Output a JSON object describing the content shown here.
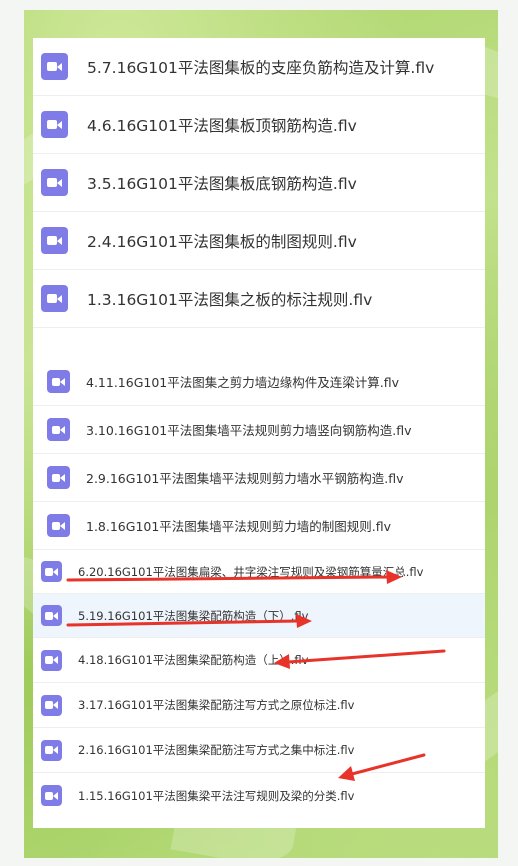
{
  "files": {
    "group_large": [
      {
        "name": "5.7.16G101平法图集板的支座负筋构造及计算.flv",
        "icon": "video-file-icon"
      },
      {
        "name": "4.6.16G101平法图集板顶钢筋构造.flv",
        "icon": "video-file-icon"
      },
      {
        "name": "3.5.16G101平法图集板底钢筋构造.flv",
        "icon": "video-file-icon"
      },
      {
        "name": "2.4.16G101平法图集板的制图规则.flv",
        "icon": "video-file-icon"
      },
      {
        "name": "1.3.16G101平法图集之板的标注规则.flv",
        "icon": "video-file-icon"
      }
    ],
    "group_medium": [
      {
        "name": "4.11.16G101平法图集之剪力墙边缘构件及连梁计算.flv",
        "icon": "video-file-icon"
      },
      {
        "name": "3.10.16G101平法图集墙平法规则剪力墙竖向钢筋构造.flv",
        "icon": "video-file-icon"
      },
      {
        "name": "2.9.16G101平法图集墙平法规则剪力墙水平钢筋构造.flv",
        "icon": "video-file-icon"
      },
      {
        "name": "1.8.16G101平法图集墙平法规则剪力墙的制图规则.flv",
        "icon": "video-file-icon"
      }
    ],
    "group_small": [
      {
        "name": "6.20.16G101平法图集扁梁、井字梁注写规则及梁钢筋算量汇总.flv",
        "icon": "video-file-icon"
      },
      {
        "name": "5.19.16G101平法图集梁配筋构造（下）.flv",
        "icon": "video-file-icon",
        "selected": true
      },
      {
        "name": "4.18.16G101平法图集梁配筋构造（上）.flv",
        "icon": "video-file-icon"
      },
      {
        "name": "3.17.16G101平法图集梁配筋注写方式之原位标注.flv",
        "icon": "video-file-icon"
      },
      {
        "name": "2.16.16G101平法图集梁配筋注写方式之集中标注.flv",
        "icon": "video-file-icon"
      },
      {
        "name": "1.15.16G101平法图集梁平法注写规则及梁的分类.flv",
        "icon": "video-file-icon"
      }
    ]
  },
  "colors": {
    "icon_bg": "#7f7ce8",
    "annotation_arrow": "#e8332a",
    "selected_row": "#eef5fc",
    "background": "#a9d366"
  }
}
